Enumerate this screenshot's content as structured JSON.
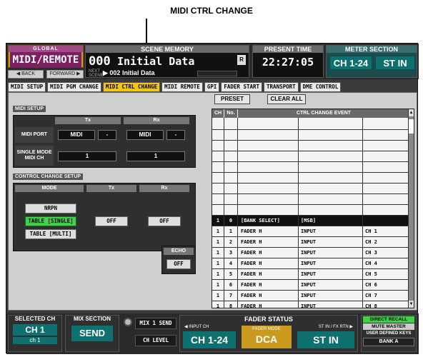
{
  "callout": {
    "label": "MIDI CTRL CHANGE"
  },
  "header": {
    "global_label": "GLOBAL",
    "mode_label": "MIDI/REMOTE",
    "back_label": "◀ BACK",
    "forward_label": "FORWARD ▶",
    "scene_memory_title": "SCENE MEMORY",
    "scene_number": "000",
    "scene_title": "Initial Data",
    "scene_flag": "R",
    "next_label": "NEXT SCENE",
    "next_scene": "▶ 002 Initial Data",
    "present_time_title": "PRESENT TIME",
    "present_time": "22:27:05",
    "meter_title": "METER SECTION",
    "meter_ch": "CH 1-24",
    "meter_st": "ST IN"
  },
  "tabs": [
    "MIDI SETUP",
    "MIDI PGM CHANGE",
    "MIDI CTRL CHANGE",
    "MIDI REMOTE",
    "GPI",
    "FADER START",
    "TRANSPORT",
    "DME CONTROL"
  ],
  "midi_setup": {
    "title": "MIDI SETUP",
    "tx_header": "Tx",
    "rx_header": "Rx",
    "port_label": "MIDI PORT",
    "single_label_1": "SINGLE MODE",
    "single_label_2": "MIDI CH",
    "tx_port": "MIDI",
    "tx_port_sub": "-",
    "rx_port": "MIDI",
    "rx_port_sub": "-",
    "tx_ch": "1",
    "rx_ch": "1"
  },
  "cc_setup": {
    "title": "CONTROL CHANGE SETUP",
    "mode_header": "MODE",
    "tx_header": "Tx",
    "rx_header": "Rx",
    "nrpn": "NRPN",
    "table_single": "TABLE [SINGLE]",
    "table_multi": "TABLE [MULTI]",
    "tx_value": "OFF",
    "rx_value": "OFF",
    "echo_label": "ECHO",
    "echo_value": "OFF"
  },
  "table": {
    "preset_label": "PRESET",
    "clear_label": "CLEAR ALL",
    "col_ch": "CH",
    "col_no": "No.",
    "col_event": "CTRL CHANGE EVENT",
    "rows": [
      {
        "ch": "1",
        "no": "0",
        "a": "[BANK SELECT]",
        "b": "[MSB]",
        "c": "",
        "highlight": true
      },
      {
        "ch": "1",
        "no": "1",
        "a": "FADER H",
        "b": "INPUT",
        "c": "CH 1",
        "highlight": false
      },
      {
        "ch": "1",
        "no": "2",
        "a": "FADER H",
        "b": "INPUT",
        "c": "CH 2",
        "highlight": false
      },
      {
        "ch": "1",
        "no": "3",
        "a": "FADER H",
        "b": "INPUT",
        "c": "CH 3",
        "highlight": false
      },
      {
        "ch": "1",
        "no": "4",
        "a": "FADER H",
        "b": "INPUT",
        "c": "CH 4",
        "highlight": false
      },
      {
        "ch": "1",
        "no": "5",
        "a": "FADER H",
        "b": "INPUT",
        "c": "CH 5",
        "highlight": false
      },
      {
        "ch": "1",
        "no": "6",
        "a": "FADER H",
        "b": "INPUT",
        "c": "CH 6",
        "highlight": false
      },
      {
        "ch": "1",
        "no": "7",
        "a": "FADER H",
        "b": "INPUT",
        "c": "CH 7",
        "highlight": false
      },
      {
        "ch": "1",
        "no": "8",
        "a": "FADER H",
        "b": "INPUT",
        "c": "CH 8",
        "highlight": false
      }
    ]
  },
  "footer": {
    "selected_ch_title": "SELECTED CH",
    "selected_ch": "CH 1",
    "selected_ch_sub": "ch 1",
    "mix_section_title": "MIX SECTION",
    "mix_section_value": "SEND",
    "mix1_send": "MIX 1 SEND",
    "ch_level": "CH LEVEL",
    "fader_status_title": "FADER STATUS",
    "input_ch_label": "◀ INPUT CH",
    "st_label": "ST IN / FX RTN ▶",
    "fader_ch": "CH 1-24",
    "fader_mode_label": "FADER MODE",
    "fader_mode": "DCA",
    "fader_st": "ST IN",
    "direct_recall": "DIRECT RECALL",
    "mute_master": "MUTE MASTER",
    "user_defined": "USER DEFINED KEYS",
    "bank": "BANK A"
  }
}
